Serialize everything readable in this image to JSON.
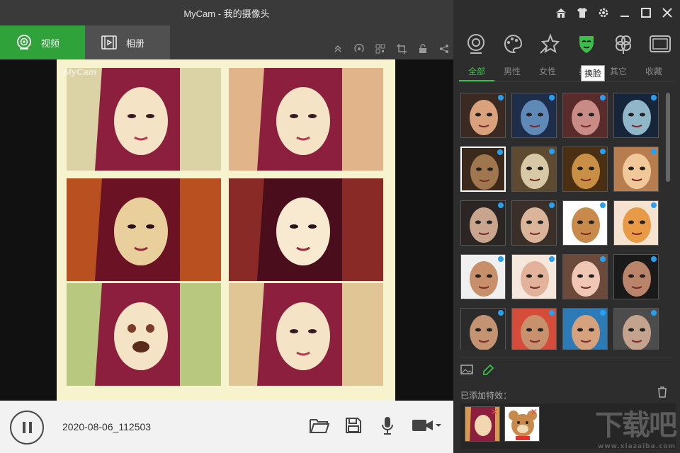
{
  "window": {
    "title": "MyCam - 我的摄像头"
  },
  "tabs": [
    {
      "label": "视频",
      "icon": "webcam-icon",
      "active": true
    },
    {
      "label": "相册",
      "icon": "film-icon",
      "active": false
    }
  ],
  "toolbar_icons": [
    "collapse-up-icon",
    "broadcast-icon",
    "qr-code-icon",
    "crop-icon",
    "lock-icon",
    "share-icon"
  ],
  "preview": {
    "watermark": "MyCam",
    "tile_count": 6
  },
  "bottombar": {
    "timestamp": "2020-08-06_112503",
    "icons": [
      "open-folder-icon",
      "save-icon",
      "microphone-icon",
      "video-camera-icon"
    ]
  },
  "right_panel": {
    "window_controls": [
      "home-icon",
      "skin-icon",
      "settings-icon",
      "minimize-icon",
      "maximize-icon",
      "close-icon"
    ],
    "categories": [
      "webcam-effect-icon",
      "palette-icon",
      "sparkle-star-icon",
      "face-mask-icon",
      "clover-icon",
      "frame-icon"
    ],
    "active_category": "face-mask-icon",
    "subtabs": [
      "全部",
      "男性",
      "女性",
      "美",
      "其它",
      "收藏"
    ],
    "active_subtab": "全部",
    "tooltip": "换脸",
    "faces": [
      {
        "name": "cat-makeup-face",
        "colors": [
          "#d9a27c",
          "#3a2a22"
        ]
      },
      {
        "name": "blue-doll-face",
        "colors": [
          "#5f8ab8",
          "#1d2d4a"
        ]
      },
      {
        "name": "vampire-face",
        "colors": [
          "#c98b86",
          "#5a2b2b"
        ]
      },
      {
        "name": "zombie-face",
        "colors": [
          "#8fb7c9",
          "#16253a"
        ]
      },
      {
        "name": "wolf-makeup-face",
        "colors": [
          "#a0764e",
          "#3b2a1c"
        ]
      },
      {
        "name": "tiger-face",
        "colors": [
          "#d8c9a6",
          "#5e4a30"
        ]
      },
      {
        "name": "leopard-face",
        "colors": [
          "#c99045",
          "#4b2f12"
        ]
      },
      {
        "name": "cat-face",
        "colors": [
          "#f0c89a",
          "#b87d4e"
        ]
      },
      {
        "name": "dog-makeup-face",
        "colors": [
          "#c9a58d",
          "#2b2624"
        ]
      },
      {
        "name": "husky-makeup-face",
        "colors": [
          "#dab59a",
          "#3b2f2a"
        ]
      },
      {
        "name": "teddy-bear-face",
        "colors": [
          "#c78a4a",
          "#ffffff"
        ]
      },
      {
        "name": "pomeranian-face",
        "colors": [
          "#e89a46",
          "#f5e3cf"
        ]
      },
      {
        "name": "man-face-1",
        "colors": [
          "#c8906a",
          "#f0f0f0"
        ]
      },
      {
        "name": "deer-girl-face",
        "colors": [
          "#e2b29a",
          "#f6e7dd"
        ]
      },
      {
        "name": "doll-face",
        "colors": [
          "#f0c7b5",
          "#6b4a3b"
        ]
      },
      {
        "name": "actor-face",
        "colors": [
          "#b98469",
          "#1a1a1a"
        ]
      },
      {
        "name": "singer-face",
        "colors": [
          "#c49372",
          "#2b2b2b"
        ]
      },
      {
        "name": "bald-man-face",
        "colors": [
          "#c8916d",
          "#d54d3a"
        ]
      },
      {
        "name": "smiling-man-face",
        "colors": [
          "#d6a27e",
          "#2d7bb6"
        ]
      },
      {
        "name": "doctor-face",
        "colors": [
          "#c4a38e",
          "#4c4c4c"
        ]
      }
    ],
    "added_label": "已添加特效：",
    "added_effects": [
      "woman-face",
      "teddy-bear-face"
    ],
    "brand": "下载吧",
    "brand_url": "www.xiazaiba.com"
  }
}
